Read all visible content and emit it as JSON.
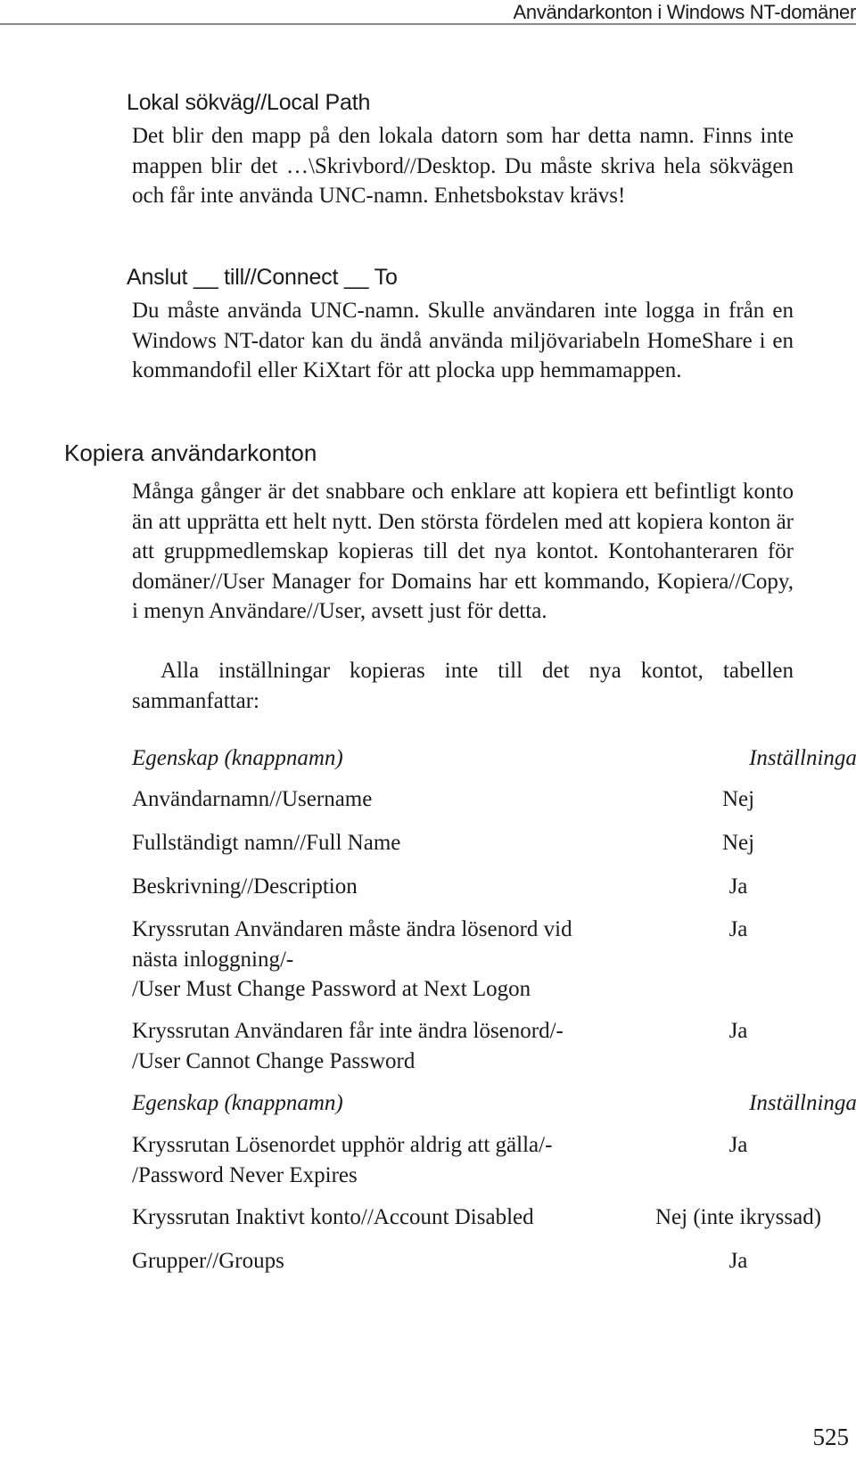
{
  "running_head": "Användarkonton i Windows NT-domäner",
  "local_path": {
    "heading": "Lokal sökväg//Local Path",
    "text": "Det blir den mapp på den lokala datorn som har detta namn. Finns inte mappen blir det …\\Skrivbord//Desktop. Du måste skriva hela sökvägen och får inte använda UNC-namn. Enhetsbokstav krävs!"
  },
  "connect_to": {
    "heading": "Anslut __ till//Connect __ To",
    "text": "Du måste använda UNC-namn. Skulle användaren inte logga in från en Windows NT-dator kan du ändå använda miljövariabeln HomeShare i en kommandofil eller KiXtart för att plocka upp hemmamappen."
  },
  "copy_section": {
    "heading": "Kopiera användarkonton",
    "paragraph1": "Många gånger är det snabbare och enklare att kopiera ett befintligt konto än att upprätta ett helt nytt. Den största fördelen med att kopiera konton är att gruppmedlemskap kopieras till det nya kontot. Kontohanteraren för domäner//User Manager for Domains har ett kommando, Kopiera//Copy, i menyn Användare//User, avsett just för detta.",
    "paragraph2": "Alla inställningar kopieras inte till det nya kontot, tabellen sammanfattar:"
  },
  "table": {
    "header": {
      "property": "Egenskap (knappnamn)",
      "copied": "Inställningar kopieras"
    },
    "rows": [
      {
        "property": "Användarnamn//Username",
        "copied": "Nej"
      },
      {
        "property": "Fullständigt namn//Full Name",
        "copied": "Nej"
      },
      {
        "property": "Beskrivning//Description",
        "copied": "Ja"
      },
      {
        "property_lines": [
          "Kryssrutan Användaren måste ändra lösenord vid",
          "nästa inloggning/-",
          "/User Must Change Password at Next Logon"
        ],
        "copied": "Ja"
      },
      {
        "property_lines": [
          "Kryssrutan Användaren får inte ändra lösenord/-",
          "/User Cannot Change Password"
        ],
        "copied": "Ja"
      },
      {
        "property_lines": [
          "Kryssrutan Lösenordet upphör aldrig att gälla/-",
          "/Password Never Expires"
        ],
        "copied": "Ja"
      },
      {
        "property": "Kryssrutan Inaktivt konto//Account Disabled",
        "copied": "Nej (inte ikryssad)"
      },
      {
        "property": "Grupper//Groups",
        "copied": "Ja"
      }
    ]
  },
  "page_number": "525"
}
